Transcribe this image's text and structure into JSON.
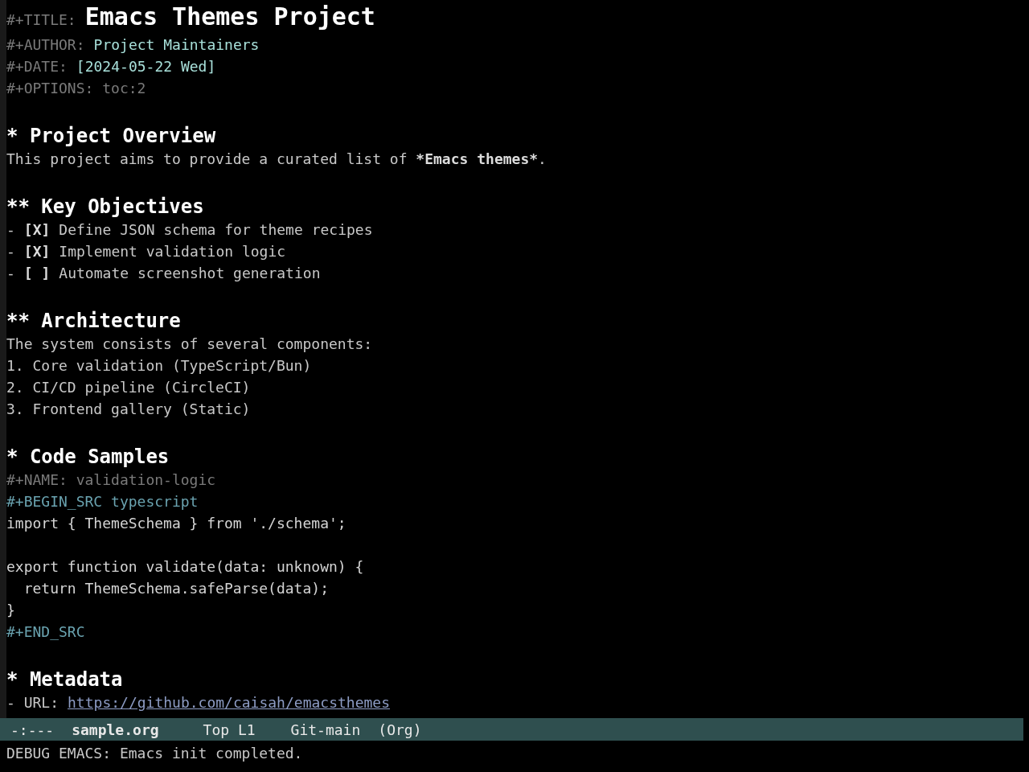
{
  "buffer": {
    "lines": [
      {
        "kind": "title",
        "key": "#+TITLE:",
        "value": "Emacs Themes Project"
      },
      {
        "kind": "meta",
        "key": "#+AUTHOR:",
        "value": "Project Maintainers"
      },
      {
        "kind": "meta",
        "key": "#+DATE:",
        "value": "[2024-05-22 Wed]"
      },
      {
        "kind": "comment",
        "text": "#+OPTIONS: toc:2"
      },
      {
        "kind": "blank"
      },
      {
        "kind": "heading",
        "text": "* Project Overview"
      },
      {
        "kind": "text",
        "text": "This project aims to provide a curated list of ",
        "bold": "*Emacs themes*",
        "after": "."
      },
      {
        "kind": "blank"
      },
      {
        "kind": "heading",
        "text": "** Key Objectives"
      },
      {
        "kind": "checkbox",
        "bullet": "-",
        "box": "[X]",
        "text": "Define JSON schema for theme recipes"
      },
      {
        "kind": "checkbox",
        "bullet": "-",
        "box": "[X]",
        "text": "Implement validation logic"
      },
      {
        "kind": "checkbox",
        "bullet": "-",
        "box": "[ ]",
        "text": "Automate screenshot generation"
      },
      {
        "kind": "blank"
      },
      {
        "kind": "heading",
        "text": "** Architecture"
      },
      {
        "kind": "text",
        "text": "The system consists of several components:"
      },
      {
        "kind": "text",
        "text": "1. Core validation (TypeScript/Bun)"
      },
      {
        "kind": "text",
        "text": "2. CI/CD pipeline (CircleCI)"
      },
      {
        "kind": "text",
        "text": "3. Frontend gallery (Static)"
      },
      {
        "kind": "blank"
      },
      {
        "kind": "heading",
        "text": "* Code Samples"
      },
      {
        "kind": "comment",
        "text": "#+NAME: validation-logic"
      },
      {
        "kind": "block",
        "text": "#+BEGIN_SRC typescript"
      },
      {
        "kind": "code",
        "text": "import { ThemeSchema } from './schema';"
      },
      {
        "kind": "blank"
      },
      {
        "kind": "code",
        "text": "export function validate(data: unknown) {"
      },
      {
        "kind": "code",
        "text": "  return ThemeSchema.safeParse(data);"
      },
      {
        "kind": "code",
        "text": "}"
      },
      {
        "kind": "block",
        "text": "#+END_SRC"
      },
      {
        "kind": "blank"
      },
      {
        "kind": "heading",
        "text": "* Metadata"
      },
      {
        "kind": "link",
        "prefix": "- URL:",
        "url": "https://github.com/caisah/emacsthemes"
      }
    ]
  },
  "mode_line": {
    "status": "-:---",
    "buffer_name": "sample.org",
    "position": "Top L1",
    "vc": "Git-main",
    "mode": "(Org)"
  },
  "echo_area": "DEBUG EMACS: Emacs init completed."
}
